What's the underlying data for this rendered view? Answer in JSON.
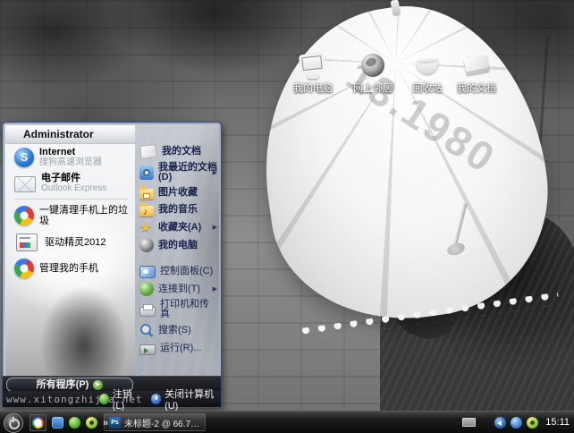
{
  "desktop": {
    "wallpaper_text": "13.1980",
    "site_watermark": "www.xitongzhijia.net",
    "icons": [
      {
        "label": "我的电脑",
        "icon": "my-computer-icon"
      },
      {
        "label": "网上邻居",
        "icon": "network-places-icon"
      },
      {
        "label": "回收站",
        "icon": "recycle-bin-icon"
      },
      {
        "label": "我的文档",
        "icon": "my-documents-icon"
      }
    ]
  },
  "start_menu": {
    "user_name": "Administrator",
    "pinned_items": [
      {
        "title": "Internet",
        "subtitle": "搜狗高速浏览器",
        "icon": "sogou-browser-icon"
      },
      {
        "title": "电子邮件",
        "subtitle": "Outlook Express",
        "icon": "outlook-express-icon"
      }
    ],
    "program_items": [
      {
        "label": "一键清理手机上的垃圾",
        "icon": "phone-cleaner-icon"
      },
      {
        "label": "驱动精灵2012",
        "icon": "driver-genius-icon"
      },
      {
        "label": "管理我的手机",
        "icon": "phone-manager-icon"
      }
    ],
    "all_programs_label": "所有程序(P)",
    "all_programs_arrow": "▶",
    "submenu_arrow": "▶",
    "right_items_top": [
      {
        "label": "我的文档",
        "icon": "my-documents-menu-icon"
      },
      {
        "label": "我最近的文档(D)",
        "icon": "recent-documents-icon"
      },
      {
        "label": "图片收藏",
        "icon": "my-pictures-icon"
      },
      {
        "label": "我的音乐",
        "icon": "my-music-icon"
      },
      {
        "label": "收藏夹(A)",
        "icon": "favorites-icon"
      },
      {
        "label": "我的电脑",
        "icon": "my-computer-menu-icon"
      }
    ],
    "right_items_bottom": [
      {
        "label": "控制面板(C)",
        "icon": "control-panel-icon"
      },
      {
        "label": "连接到(T)",
        "icon": "connect-to-icon"
      },
      {
        "label": "打印机和传真",
        "icon": "printers-faxes-icon"
      },
      {
        "label": "搜索(S)",
        "icon": "search-icon"
      },
      {
        "label": "运行(R)...",
        "icon": "run-icon"
      }
    ],
    "logoff_label": "注销(L)",
    "shutdown_label": "关闭计算机(U)"
  },
  "taskbar": {
    "quick_launch_overflow": "»",
    "task_button": {
      "label": "未标题-2 @ 66.7% ...",
      "icon_text": "Ps"
    },
    "clock": "15:11"
  }
}
